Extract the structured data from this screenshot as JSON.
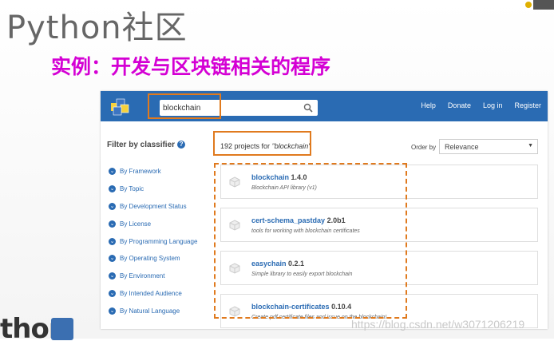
{
  "slide": {
    "title": "Python社区",
    "subtitle": "实例：开发与区块链相关的程序",
    "bg_logo_text": "thon",
    "watermark": "https://blog.csdn.net/w3071206219"
  },
  "colors": {
    "accent": "#2a6bb3",
    "highlight": "#e07a1e",
    "subtitle": "#d400d4"
  },
  "header": {
    "search_value": "blockchain",
    "nav": [
      "Help",
      "Donate",
      "Log in",
      "Register"
    ]
  },
  "sidebar": {
    "title": "Filter by classifier",
    "filters": [
      "By Framework",
      "By Topic",
      "By Development Status",
      "By License",
      "By Programming Language",
      "By Operating System",
      "By Environment",
      "By Intended Audience",
      "By Natural Language"
    ]
  },
  "results_header": {
    "count_prefix": "192 projects for",
    "query": "\"blockchain\"",
    "order_label": "Order by",
    "order_value": "Relevance"
  },
  "results": [
    {
      "name": "blockchain",
      "version": "1.4.0",
      "desc": "Blockchain API library (v1)"
    },
    {
      "name": "cert-schema_pastday",
      "version": "2.0b1",
      "desc": "tools for working with blockchain certificates"
    },
    {
      "name": "easychain",
      "version": "0.2.1",
      "desc": "Simple library to easily export blockchain"
    },
    {
      "name": "blockchain-certificates",
      "version": "0.10.4",
      "desc": "Create pdf certificate files and issue on the blockchain!"
    }
  ]
}
